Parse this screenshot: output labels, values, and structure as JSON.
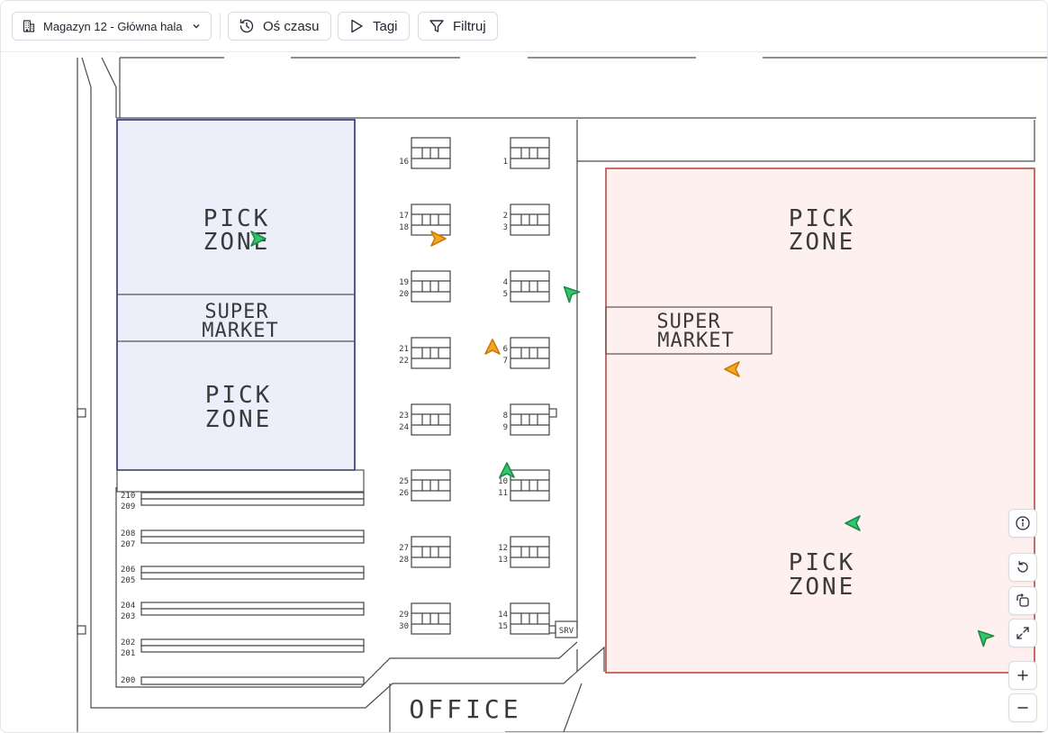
{
  "toolbar": {
    "location_select": {
      "value": "Magazyn 12 - Główna hala"
    },
    "timeline_label": "Oś czasu",
    "tags_label": "Tagi",
    "filter_label": "Filtruj"
  },
  "floorplan": {
    "left_zone": {
      "pick_top": [
        "PICK",
        "ZONE"
      ],
      "super_market": [
        "SUPER",
        "MARKET"
      ],
      "pick_bottom": [
        "PICK",
        "ZONE"
      ]
    },
    "right_zone": {
      "pick_top": [
        "PICK",
        "ZONE"
      ],
      "super_market": [
        "SUPER",
        "MARKET"
      ],
      "pick_bottom": [
        "PICK",
        "ZONE"
      ]
    },
    "office_label": "OFFICE",
    "srv_label": "SRV",
    "rack_labels_left": [
      [
        "16"
      ],
      [
        "17",
        "18"
      ],
      [
        "19",
        "20"
      ],
      [
        "21",
        "22"
      ],
      [
        "23",
        "24"
      ],
      [
        "25",
        "26"
      ],
      [
        "27",
        "28"
      ],
      [
        "29",
        "30"
      ]
    ],
    "rack_labels_right": [
      [
        "1"
      ],
      [
        "2",
        "3"
      ],
      [
        "4",
        "5"
      ],
      [
        "6",
        "7"
      ],
      [
        "8",
        "9"
      ],
      [
        "10",
        "11"
      ],
      [
        "12",
        "13"
      ],
      [
        "14",
        "15"
      ]
    ],
    "shelf_labels": [
      [
        "210",
        "209"
      ],
      [
        "208",
        "207"
      ],
      [
        "206",
        "205"
      ],
      [
        "204",
        "203"
      ],
      [
        "202",
        "201"
      ],
      [
        "200"
      ]
    ]
  },
  "markers": [
    {
      "color": "#34c46a",
      "heading": "east"
    },
    {
      "color": "#f5a623",
      "heading": "east"
    },
    {
      "color": "#34c46a",
      "heading": "north-west"
    },
    {
      "color": "#f5a623",
      "heading": "north"
    },
    {
      "color": "#f5a623",
      "heading": "west"
    },
    {
      "color": "#34c46a",
      "heading": "north"
    },
    {
      "color": "#34c46a",
      "heading": "west"
    },
    {
      "color": "#34c46a",
      "heading": "north-west"
    }
  ],
  "map_controls": [
    "info-icon",
    "reset-rotation-icon",
    "rotate-view-icon",
    "fullscreen-icon",
    "zoom-in-icon",
    "zoom-out-icon"
  ],
  "colors": {
    "left_zone_fill": "#eceefa",
    "left_zone_border": "#2a2f7a",
    "right_zone_fill": "#fdf0ee",
    "right_zone_border": "#b84a45",
    "marker_green": "#34c46a",
    "marker_orange": "#f5a623"
  }
}
